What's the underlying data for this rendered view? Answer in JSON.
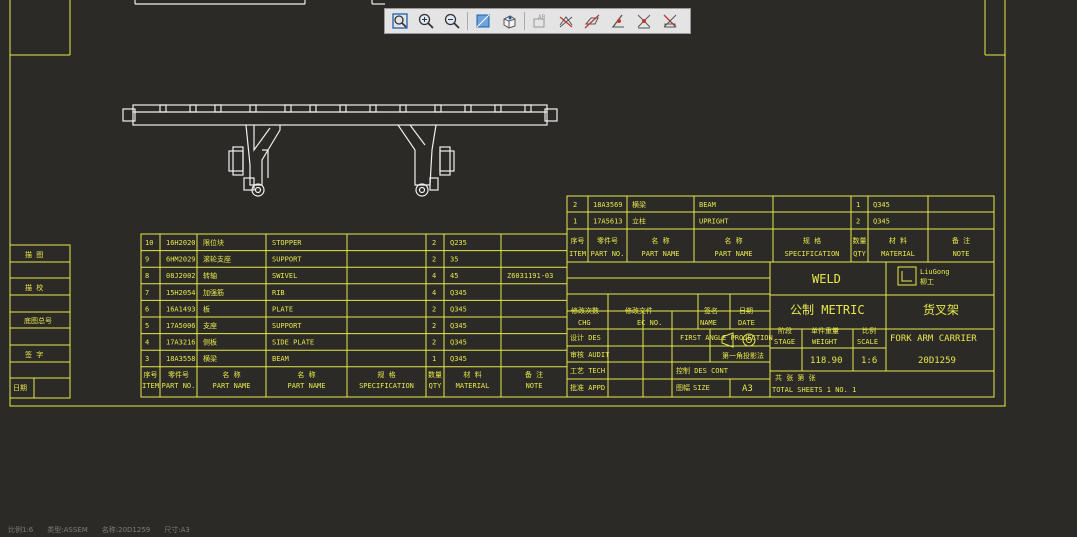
{
  "toolbar": {
    "buttons": [
      {
        "name": "zoom-fit-icon"
      },
      {
        "name": "zoom-in-icon"
      },
      {
        "name": "zoom-out-icon"
      },
      {
        "name": "display-style-icon"
      },
      {
        "name": "view-orientation-icon"
      },
      {
        "name": "annotation-display-icon"
      },
      {
        "name": "datum-planes-icon"
      },
      {
        "name": "datum-axes-icon"
      },
      {
        "name": "datum-points-icon"
      },
      {
        "name": "coordinate-systems-icon"
      },
      {
        "name": "spin-center-icon"
      }
    ]
  },
  "side_labels": [
    "描  图",
    "描  校",
    "底图总号",
    "签  字",
    "日期"
  ],
  "bom_left": {
    "rows": [
      {
        "item": "10",
        "part_no": "16H2020",
        "cn": "限位块",
        "name": "STOPPER",
        "qty": "2",
        "material": "Q235",
        "note": ""
      },
      {
        "item": "9",
        "part_no": "6HM2029",
        "cn": "滚轮支座",
        "name": "SUPPORT",
        "qty": "2",
        "material": "35",
        "note": ""
      },
      {
        "item": "8",
        "part_no": "08J2002",
        "cn": "转轴",
        "name": "SWIVEL",
        "qty": "4",
        "material": "45",
        "note": "Z6031191-03"
      },
      {
        "item": "7",
        "part_no": "15H2054",
        "cn": "加强筋",
        "name": "RIB",
        "qty": "4",
        "material": "Q345",
        "note": ""
      },
      {
        "item": "6",
        "part_no": "16A1493",
        "cn": "板",
        "name": "PLATE",
        "qty": "2",
        "material": "Q345",
        "note": ""
      },
      {
        "item": "5",
        "part_no": "17A5006",
        "cn": "支座",
        "name": "SUPPORT",
        "qty": "2",
        "material": "Q345",
        "note": ""
      },
      {
        "item": "4",
        "part_no": "17A3216",
        "cn": "侧板",
        "name": "SIDE PLATE",
        "qty": "2",
        "material": "Q345",
        "note": ""
      },
      {
        "item": "3",
        "part_no": "18A3558",
        "cn": "横梁",
        "name": "BEAM",
        "qty": "1",
        "material": "Q345",
        "note": ""
      }
    ],
    "header": {
      "item_cn": "序号",
      "item_en": "ITEM",
      "part_no_cn": "零件号",
      "part_no_en": "PART NO.",
      "cn_name_cn": "名  称",
      "cn_name_en": "PART NAME",
      "name_cn": "名  称",
      "name_en": "PART NAME",
      "spec_cn": "规  格",
      "spec_en": "SPECIFICATION",
      "qty_cn": "数量",
      "qty_en": "QTY",
      "material_cn": "材  料",
      "material_en": "MATERIAL",
      "note_cn": "备  注",
      "note_en": "NOTE"
    }
  },
  "bom_right": {
    "rows": [
      {
        "item": "2",
        "part_no": "18A3569",
        "cn": "横梁",
        "name": "BEAM",
        "qty": "1",
        "material": "Q345",
        "note": ""
      },
      {
        "item": "1",
        "part_no": "17A5613",
        "cn": "立柱",
        "name": "UPRIGHT",
        "qty": "2",
        "material": "Q345",
        "note": ""
      }
    ]
  },
  "title_block": {
    "weld": "WELD",
    "metric": "公制 METRIC",
    "logo_text": "LiuGong",
    "logo_cn": "柳工",
    "title_cn": "货叉架",
    "title_en": "FORK ARM CARRIER",
    "drawing_no": "20D1259",
    "stage_cn": "阶段",
    "stage_en": "STAGE",
    "weight_cn": "单件重量",
    "weight_en": "WEIGHT",
    "weight": "118.90",
    "scale_cn": "比例",
    "scale_en": "SCALE",
    "scale": "1:6",
    "sheets": "共    张    第    张",
    "sheets_en": "TOTAL SHEETS 1        NO. 1",
    "chg_cn": "修改次数",
    "chg_en": "CHG",
    "ecno_cn": "修改文件",
    "ecno_en": "EC NO.",
    "name_cn": "签名",
    "name_en": "NAME",
    "date_cn": "日期",
    "date_en": "DATE",
    "design": "设计 DES",
    "audit": "审核 AUDIT",
    "tech": "工艺 TECH",
    "appd": "批准 APPD",
    "projection": "FIRST ANGLE PROJECTION",
    "projection_cn": "第一角投影法",
    "cont": "控制 DES CONT",
    "size_cn": "图幅",
    "size_en": "SIZE",
    "size": "A3"
  },
  "status": {
    "sheet": "比例1:6",
    "type": "类型:ASSEM",
    "name": "名称:20D1259",
    "size": "尺寸:A3"
  }
}
